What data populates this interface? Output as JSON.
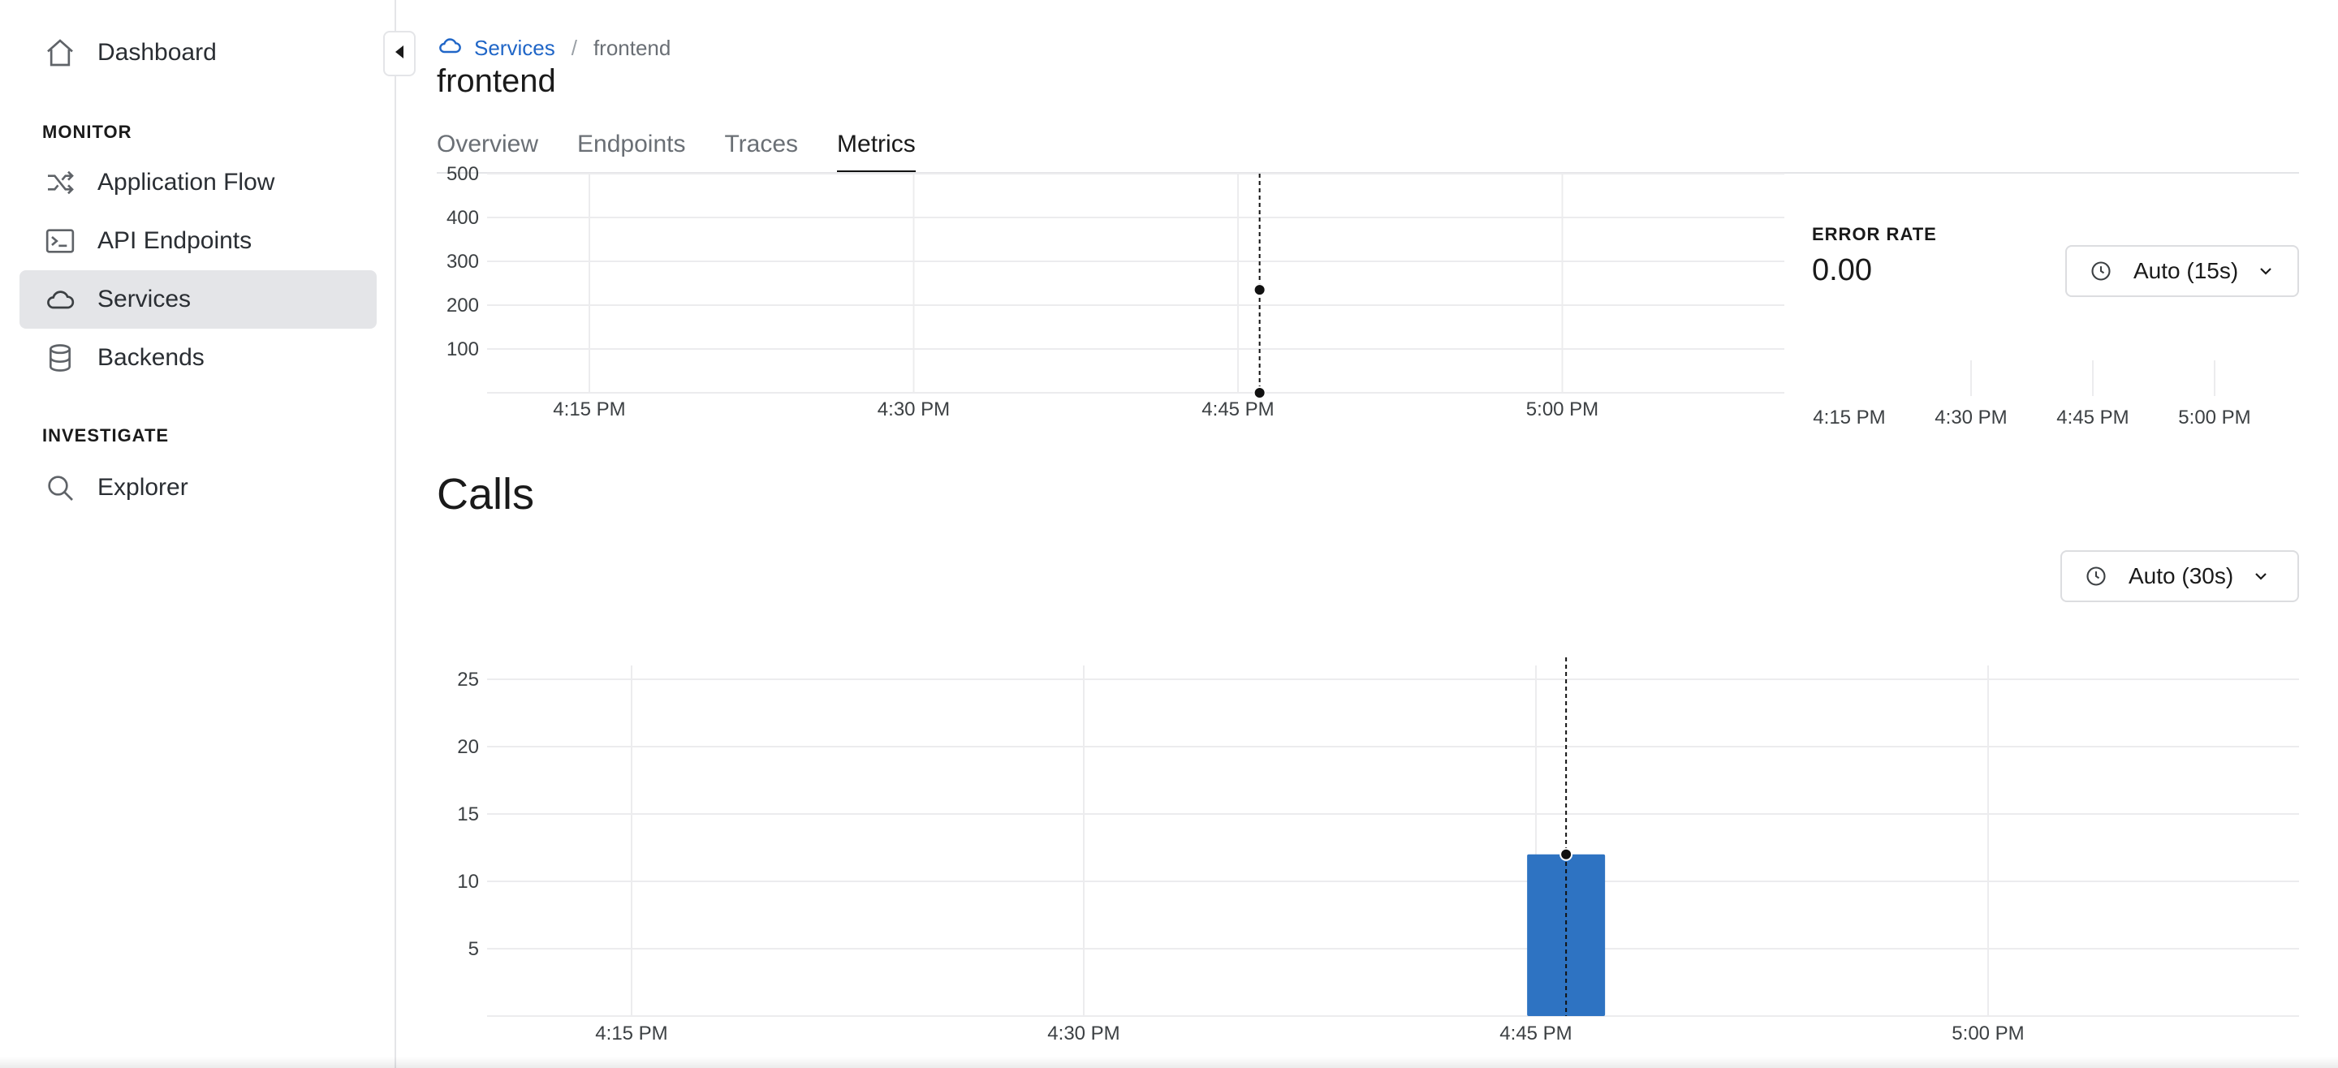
{
  "sidebar": {
    "items": [
      {
        "label": "Dashboard",
        "icon": "home-icon"
      },
      {
        "label": "Application Flow",
        "icon": "shuffle-icon"
      },
      {
        "label": "API Endpoints",
        "icon": "terminal-icon"
      },
      {
        "label": "Services",
        "icon": "cloud-icon",
        "active": true
      },
      {
        "label": "Backends",
        "icon": "database-icon"
      },
      {
        "label": "Explorer",
        "icon": "search-icon"
      }
    ],
    "sections": {
      "monitor": "MONITOR",
      "investigate": "INVESTIGATE"
    }
  },
  "breadcrumb": {
    "parent": "Services",
    "current": "frontend"
  },
  "page_title": "frontend",
  "tabs": [
    {
      "label": "Overview"
    },
    {
      "label": "Endpoints"
    },
    {
      "label": "Traces"
    },
    {
      "label": "Metrics",
      "active": true
    }
  ],
  "error_rate": {
    "label": "ERROR RATE",
    "value": "0.00",
    "interval": "Auto (15s)"
  },
  "calls_section": {
    "title": "Calls",
    "interval": "Auto (30s)"
  },
  "colors": {
    "accent": "#2066c7",
    "bar": "#2e73c2"
  },
  "chart_data": [
    {
      "type": "line",
      "name": "latency",
      "x": [
        "4:15 PM",
        "4:30 PM",
        "4:45 PM",
        "5:00 PM"
      ],
      "y_ticks": [
        100,
        200,
        300,
        400,
        500
      ],
      "ylim": [
        0,
        500
      ],
      "hover_time": "4:46 PM",
      "points": [
        {
          "x": "4:46 PM",
          "y": 235
        },
        {
          "x": "4:46 PM",
          "y": 0
        }
      ],
      "grid": true
    },
    {
      "type": "line",
      "name": "error_rate",
      "x": [
        "4:15 PM",
        "4:30 PM",
        "4:45 PM",
        "5:00 PM"
      ],
      "values": [],
      "grid": true
    },
    {
      "type": "bar",
      "name": "calls",
      "x": [
        "4:15 PM",
        "4:30 PM",
        "4:45 PM",
        "5:00 PM"
      ],
      "y_ticks": [
        5,
        10,
        15,
        20,
        25
      ],
      "ylim": [
        0,
        25
      ],
      "bars": [
        {
          "x": "4:46 PM",
          "value": 12
        }
      ],
      "hover_time": "4:46 PM",
      "grid": true
    }
  ]
}
